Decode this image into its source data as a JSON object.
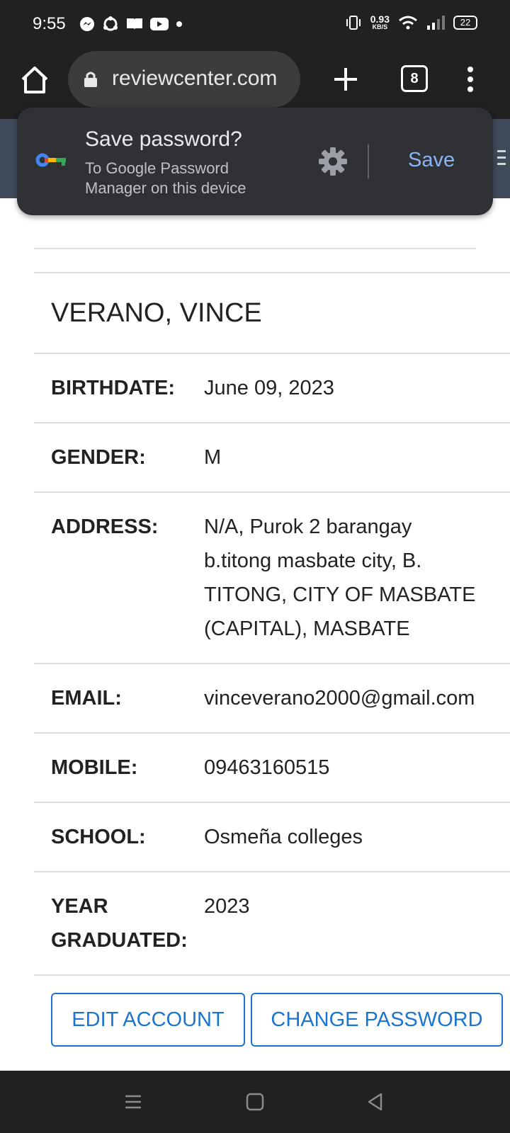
{
  "status_bar": {
    "time": "9:55",
    "left_icons": [
      "messenger-icon",
      "sync-icon",
      "book-icon",
      "youtube-icon",
      "dot-icon"
    ],
    "net_speed_value": "0.93",
    "net_speed_unit": "KB/S",
    "battery": "22"
  },
  "browser": {
    "url": "reviewcenter.com",
    "tab_count": "8"
  },
  "save_password_popup": {
    "title": "Save password?",
    "subtitle": "To Google Password Manager on this device",
    "save_label": "Save"
  },
  "profile": {
    "name": "VERANO, VINCE",
    "fields": [
      {
        "label": "BIRTHDATE:",
        "value": "June 09, 2023"
      },
      {
        "label": "GENDER:",
        "value": "M"
      },
      {
        "label": "ADDRESS:",
        "value": "N/A, Purok 2 barangay\nb.titong masbate city, B.\nTITONG, CITY OF MASBATE\n(CAPITAL), MASBATE"
      },
      {
        "label": "EMAIL:",
        "value": "vinceverano2000@gmail.com"
      },
      {
        "label": "MOBILE:",
        "value": "09463160515"
      },
      {
        "label": "SCHOOL:",
        "value": "Osmeña colleges"
      },
      {
        "label": "YEAR\nGRADUATED:",
        "value": "2023"
      }
    ]
  },
  "actions": {
    "edit_label": "EDIT ACCOUNT",
    "change_password_label": "CHANGE PASSWORD"
  }
}
